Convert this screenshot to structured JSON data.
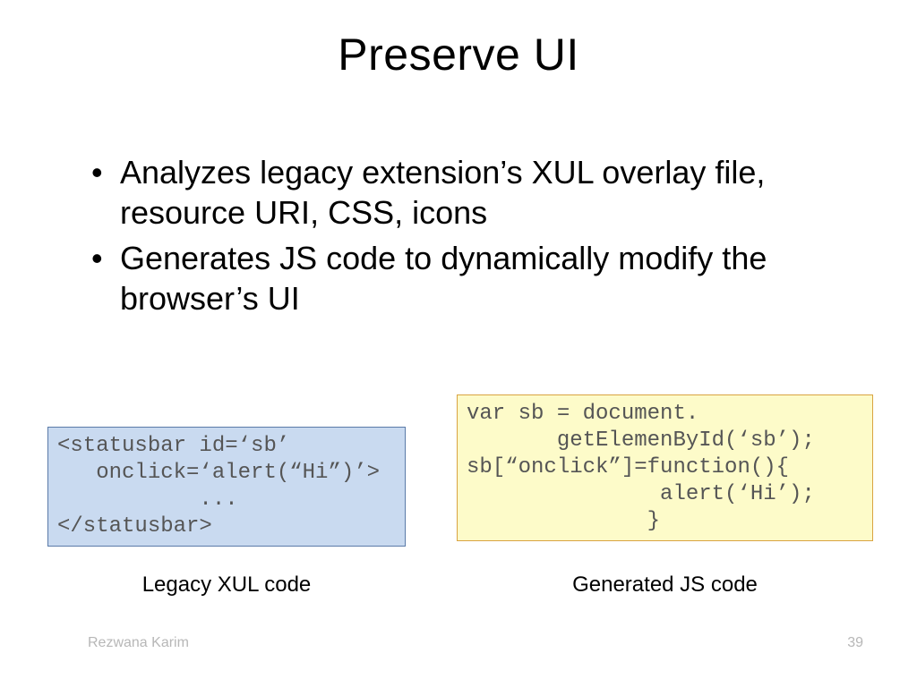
{
  "title": "Preserve UI",
  "bullets": [
    "Analyzes legacy extension’s XUL overlay file, resource URI, CSS, icons",
    "Generates JS code to dynamically modify the browser’s UI"
  ],
  "xul_code": "<statusbar id=‘sb’\n   onclick=‘alert(“Hi”)’>\n           ...\n</statusbar>",
  "js_code": "var sb = document.\n       getElemenById(‘sb’);\nsb[“onclick”]=function(){\n               alert(‘Hi’);\n              }",
  "caption_xul": "Legacy XUL code",
  "caption_js": "Generated JS code",
  "footer_author": "Rezwana Karim",
  "footer_page": "39"
}
